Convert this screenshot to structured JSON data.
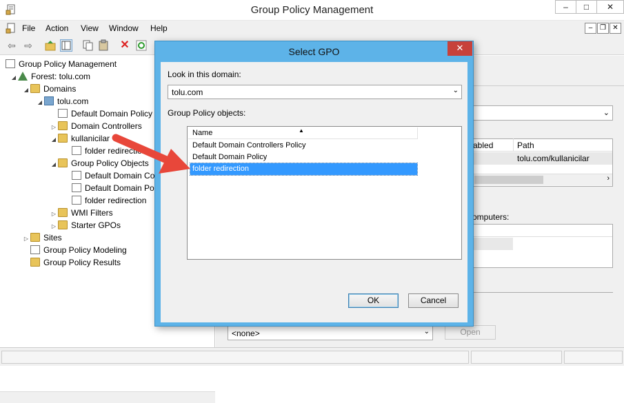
{
  "window": {
    "title": "Group Policy Management",
    "controls": {
      "minimize": "–",
      "maximize": "□",
      "close": "✕"
    }
  },
  "menu": [
    "File",
    "Action",
    "View",
    "Window",
    "Help"
  ],
  "mdi_controls": {
    "minimize": "–",
    "restore": "❐",
    "close": "✕"
  },
  "tree": {
    "root": "Group Policy Management",
    "forest": "Forest: tolu.com",
    "domains": "Domains",
    "domain": "tolu.com",
    "default_policy": "Default Domain Policy",
    "domain_controllers": "Domain Controllers",
    "ou": "kullanicilar",
    "ou_link": "folder redirection",
    "gpo_container": "Group Policy Objects",
    "gpo_1": "Default Domain Co",
    "gpo_2": "Default Domain Po",
    "gpo_3": "folder redirection",
    "wmi": "WMI Filters",
    "starter": "Starter GPOs",
    "sites": "Sites",
    "modeling": "Group Policy Modeling",
    "results": "Group Policy Results"
  },
  "right_pane": {
    "col_enabled": "abled",
    "col_path": "Path",
    "path_value": "tolu.com/kullanicilar",
    "computers_label": "omputers:",
    "wmi_select": "<none>",
    "open_button": "Open"
  },
  "dialog": {
    "title": "Select GPO",
    "close": "✕",
    "look_in_label": "Look in this domain:",
    "domain_value": "tolu.com",
    "objects_label": "Group Policy objects:",
    "column_name": "Name",
    "items": [
      "Default Domain Controllers Policy",
      "Default Domain Policy",
      "folder redirection"
    ],
    "selected_index": 2,
    "ok": "OK",
    "cancel": "Cancel"
  },
  "colors": {
    "dialog_frame": "#5db3e8",
    "selection": "#3399ff",
    "close_red": "#c7413b",
    "arrow": "#e8473a"
  }
}
